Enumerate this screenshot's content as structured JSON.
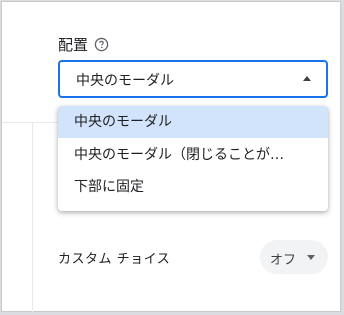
{
  "placement": {
    "label": "配置",
    "help_icon": "help-circle-icon",
    "selected_value": "中央のモーダル",
    "options": [
      "中央のモーダル",
      "中央のモーダル（閉じることが…",
      "下部に固定"
    ]
  },
  "custom_choice": {
    "label": "カスタム チョイス",
    "toggle_value": "オフ"
  },
  "colors": {
    "accent": "#1a73e8",
    "selected_option_bg": "#d2e3fc",
    "chip_bg": "#f1f3f4"
  }
}
